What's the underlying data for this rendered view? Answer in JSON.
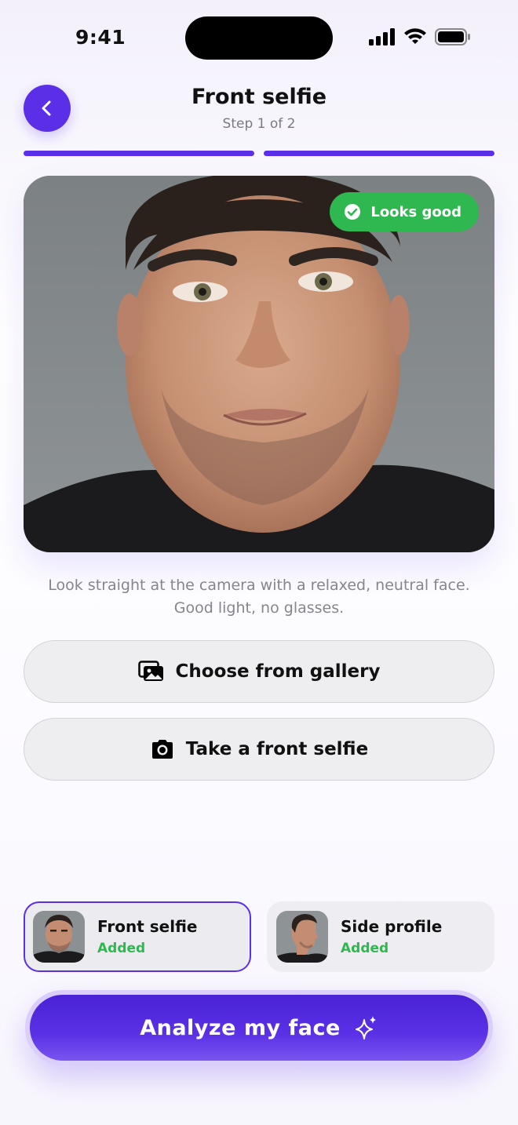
{
  "status_bar": {
    "time": "9:41"
  },
  "header": {
    "title": "Front selfie",
    "subtitle": "Step 1 of 2",
    "back_icon": "chevron-left-icon"
  },
  "progress": {
    "total_steps": 2,
    "completed_steps": 2
  },
  "photo": {
    "badge_label": "Looks good",
    "badge_icon": "check-circle-icon"
  },
  "hint": "Look straight at the camera with a relaxed, neutral face. Good light, no glasses.",
  "actions": {
    "gallery_label": "Choose from gallery",
    "gallery_icon": "gallery-icon",
    "camera_label": "Take a front selfie",
    "camera_icon": "camera-icon"
  },
  "thumbs": [
    {
      "title": "Front selfie",
      "status": "Added",
      "selected": true
    },
    {
      "title": "Side profile",
      "status": "Added",
      "selected": false
    }
  ],
  "cta": {
    "label": "Analyze my face",
    "icon": "sparkle-icon"
  },
  "colors": {
    "accent": "#5b2ee8",
    "success": "#2fb84f",
    "muted_text": "#85858b"
  }
}
